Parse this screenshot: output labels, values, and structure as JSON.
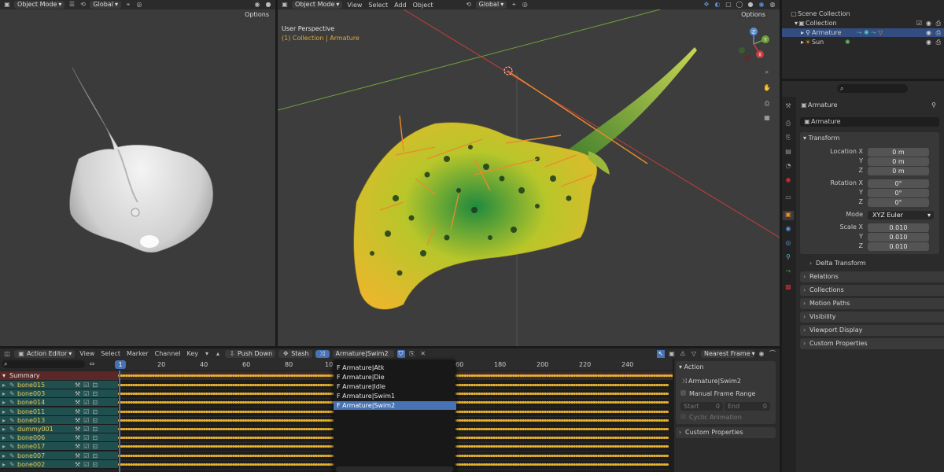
{
  "left_viewport": {
    "mode": "Object Mode",
    "transform": "Global",
    "options": "Options"
  },
  "main_viewport": {
    "mode": "Object Mode",
    "menu": [
      "View",
      "Select",
      "Add",
      "Object"
    ],
    "transform": "Global",
    "options": "Options",
    "overlay_title": "User Perspective",
    "overlay_context": "(1) Collection | Armature",
    "gizmo_axes": [
      "Z",
      "Y",
      "X"
    ]
  },
  "outliner": {
    "items": [
      {
        "label": "Scene Collection"
      },
      {
        "label": "Collection"
      },
      {
        "label": "Armature"
      },
      {
        "label": "Sun"
      }
    ]
  },
  "properties": {
    "object_name": "Armature",
    "object_field": "Armature",
    "transform_label": "Transform",
    "location": {
      "label": "Location X",
      "x": "0 m",
      "y": "0 m",
      "z": "0 m"
    },
    "rotation": {
      "label": "Rotation X",
      "x": "0°",
      "y": "0°",
      "z": "0°"
    },
    "mode": {
      "label": "Mode",
      "value": "XYZ Euler"
    },
    "scale": {
      "label": "Scale X",
      "x": "0.010",
      "y": "0.010",
      "z": "0.010"
    },
    "axis_y": "Y",
    "axis_z": "Z",
    "delta": "Delta Transform",
    "sections": [
      "Relations",
      "Collections",
      "Motion Paths",
      "Visibility",
      "Viewport Display",
      "Custom Properties"
    ]
  },
  "action_editor": {
    "editor_type": "Action Editor",
    "menu": [
      "View",
      "Select",
      "Marker",
      "Channel",
      "Key"
    ],
    "push_down": "Push Down",
    "stash": "Stash",
    "action_name": "Armature|Swim2",
    "nearest_frame": "Nearest Frame",
    "current_frame": "1",
    "ruler_left": [
      "20",
      "40",
      "60",
      "80",
      "10"
    ],
    "ruler_right": [
      "60",
      "180",
      "200",
      "220",
      "240"
    ],
    "summary": "Summary",
    "channels": [
      "bone015",
      "bone003",
      "bone014",
      "bone011",
      "bone013",
      "dummy001",
      "bone006",
      "bone017",
      "bone007",
      "bone002"
    ],
    "dropdown_items": [
      "F Armature|Atk",
      "F Armature|Die",
      "F Armature|Idle",
      "F Armature|Swim1",
      "F Armature|Swim2"
    ],
    "dropdown_selected_index": 4
  },
  "action_panel": {
    "title": "Action",
    "action_name": "Armature|Swim2",
    "manual_frame_range": "Manual Frame Range",
    "start_label": "Start",
    "start_value": "0",
    "end_label": "End",
    "end_value": "0",
    "cyclic": "Cyclic Animation",
    "custom_props": "Custom Properties"
  },
  "colors": {
    "keyframe": "#e7b22d",
    "selected": "#4772b3",
    "channel_bg": "#1f4f4f",
    "x_axis": "#c83c3c",
    "y_axis": "#6fa13a",
    "bone": "#e98c2b"
  }
}
